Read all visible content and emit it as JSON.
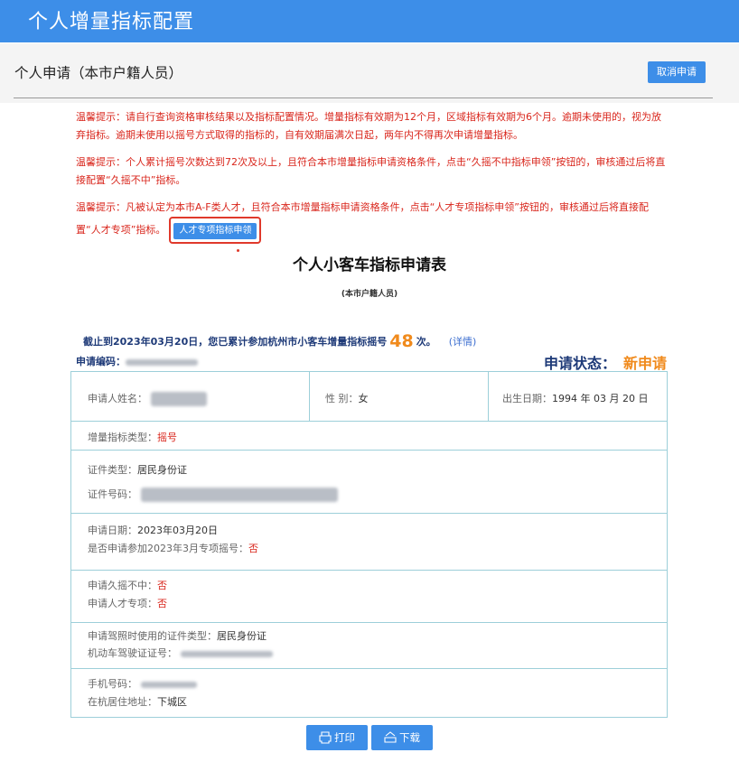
{
  "header": {
    "title": "个人增量指标配置"
  },
  "subheader": {
    "title": "个人申请（本市户籍人员）",
    "cancel_label": "取消申请"
  },
  "notices": [
    "温馨提示：请自行查询资格审核结果以及指标配置情况。增量指标有效期为12个月，区域指标有效期为6个月。逾期未使用的，视为放弃指标。逾期未使用以摇号方式取得的指标的，自有效期届满次日起，两年内不得再次申请增量指标。",
    "温馨提示：个人累计摇号次数达到72次及以上，且符合本市增量指标申请资格条件，点击“久摇不中指标申领”按钮的，审核通过后将直接配置“久摇不中”指标。",
    "温馨提示：凡被认定为本市A-F类人才，且符合本市增量指标申请资格条件，点击“人才专项指标申领”按钮的，审核通过后将直接配置“人才专项”指标。"
  ],
  "talent_button": "人才专项指标申领",
  "form": {
    "title": "个人小客车指标申请表",
    "subtitle": "(本市户籍人员)",
    "count_prefix": "截止到2023年03月20日，您已累计参加杭州市小客车增量指标摇号",
    "count": "48",
    "count_suffix": "次。",
    "detail_link": "(详情)",
    "code_label": "申请编码：",
    "status_label": "申请状态：",
    "status_value": "新申请"
  },
  "table": {
    "name_label": "申请人姓名：",
    "gender_label": "性 别：",
    "gender_value": "女",
    "birth_label": "出生日期：",
    "birth_value": "1994 年 03 月 20 日",
    "type_label": "增量指标类型：",
    "type_value": "摇号",
    "id_type_label": "证件类型：",
    "id_type_value": "居民身份证",
    "id_no_label": "证件号码：",
    "apply_date_label": "申请日期：",
    "apply_date_value": "2023年03月20日",
    "special_label": "是否申请参加2023年3月专项摇号：",
    "special_value": "否",
    "long_label": "申请久摇不中：",
    "long_value": "否",
    "talent_label": "申请人才专项：",
    "talent_value": "否",
    "license_id_type_label": "申请驾照时使用的证件类型：",
    "license_id_type_value": "居民身份证",
    "license_no_label": "机动车驾驶证证号：",
    "phone_label": "手机号码：",
    "address_label": "在杭居住地址：",
    "address_value": "下城区"
  },
  "actions": {
    "print_label": "打印",
    "download_label": "下载"
  },
  "colors": {
    "primary": "#3d8ee8",
    "notice": "#d9261c",
    "status": "#f08a1c",
    "border": "#9dcfd9"
  }
}
